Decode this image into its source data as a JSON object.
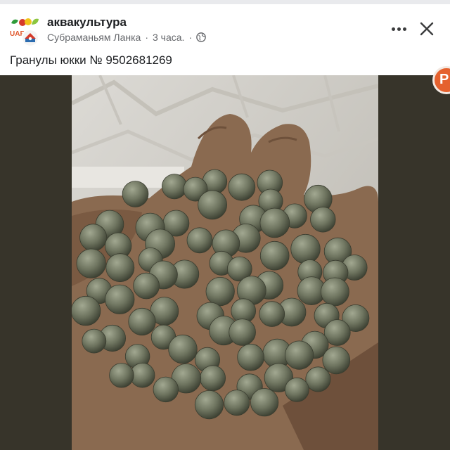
{
  "post": {
    "group_name": "аквакультура",
    "author": "Субраманьям Ланка",
    "separator": "·",
    "time": "3 часа.",
    "privacy_icon": "globe-icon",
    "caption": "Гранулы юкки № 9502681269"
  },
  "actions": {
    "more_icon": "more-dots-icon",
    "close_icon": "close-icon"
  },
  "group_logo_text": "UAF",
  "side_avatar_letter": "P",
  "colors": {
    "text_primary": "#1c1e21",
    "text_secondary": "#65676b",
    "photo_background": "#37342a",
    "pellet": "#6f7560"
  }
}
